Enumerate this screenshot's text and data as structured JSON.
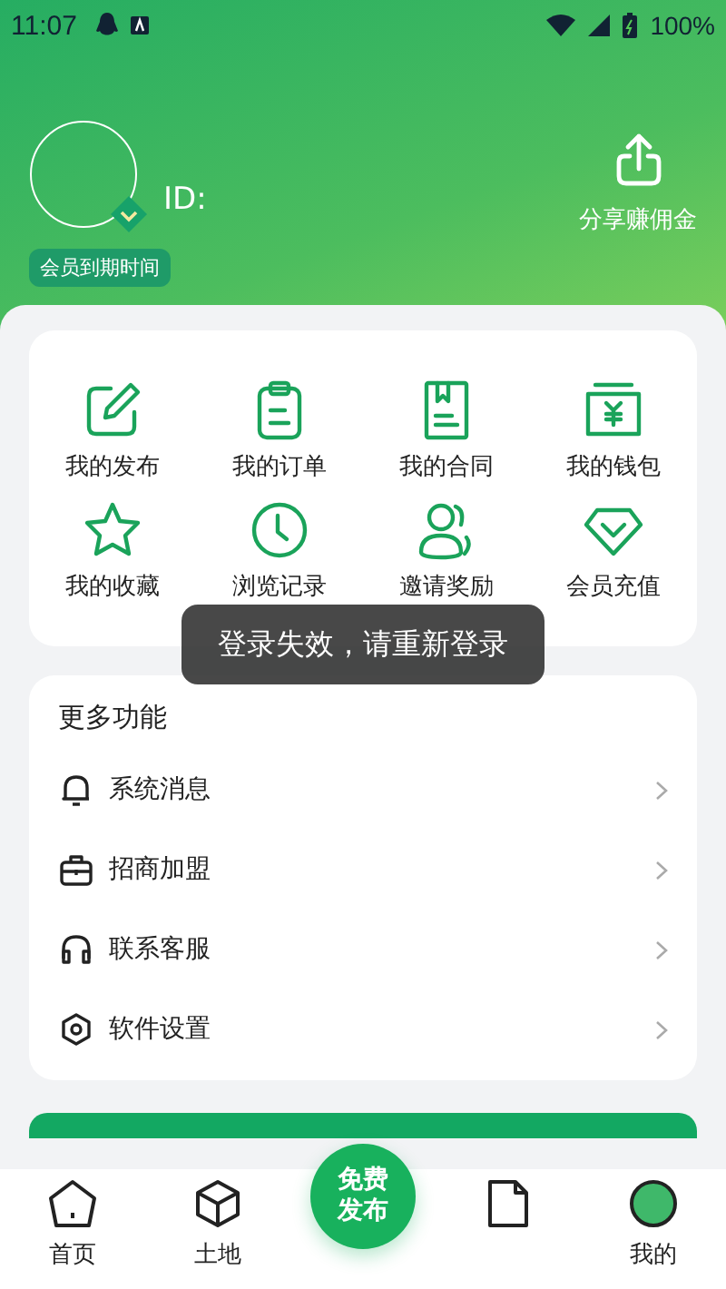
{
  "status_bar": {
    "time": "11:07",
    "battery": "100%"
  },
  "profile": {
    "id_label": "ID:",
    "member_badge": "会员到期时间",
    "share_label": "分享赚佣金"
  },
  "shortcuts": [
    {
      "kind": "publish",
      "label": "我的发布"
    },
    {
      "kind": "order",
      "label": "我的订单"
    },
    {
      "kind": "contract",
      "label": "我的合同"
    },
    {
      "kind": "wallet",
      "label": "我的钱包"
    },
    {
      "kind": "favorite",
      "label": "我的收藏"
    },
    {
      "kind": "history",
      "label": "浏览记录"
    },
    {
      "kind": "invite",
      "label": "邀请奖励"
    },
    {
      "kind": "vip",
      "label": "会员充值"
    }
  ],
  "more": {
    "title": "更多功能",
    "items": [
      {
        "kind": "bell",
        "label": "系统消息"
      },
      {
        "kind": "bag",
        "label": "招商加盟"
      },
      {
        "kind": "headset",
        "label": "联系客服"
      },
      {
        "kind": "settings",
        "label": "软件设置"
      }
    ]
  },
  "toast": "登录失效，请重新登录",
  "bottom_nav": {
    "items": [
      {
        "kind": "home",
        "label": "首页"
      },
      {
        "kind": "cube",
        "label": "土地"
      },
      {
        "kind": "publish",
        "label": "免费发布"
      },
      {
        "kind": "doc"
      },
      {
        "kind": "me",
        "label": "我的"
      }
    ]
  }
}
